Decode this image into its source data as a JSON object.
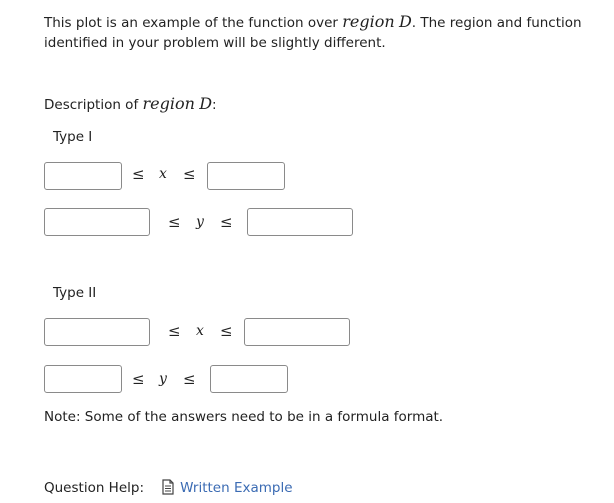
{
  "intro": {
    "text_before": "This plot is an example of the function over ",
    "math_term": "region",
    "math_symbol": "D",
    "text_after": ".  The region and function identified in your problem will be slightly different."
  },
  "description": {
    "label": "Description of ",
    "math_term": "region",
    "math_symbol": "D",
    "suffix": ":"
  },
  "type1": {
    "label": "Type I",
    "row1": {
      "lower_value": "",
      "op_left": "≤",
      "variable": "x",
      "op_right": "≤",
      "upper_value": ""
    },
    "row2": {
      "lower_value": "",
      "op_left": "≤",
      "variable": "y",
      "op_right": "≤",
      "upper_value": ""
    }
  },
  "type2": {
    "label": "Type II",
    "row1": {
      "lower_value": "",
      "op_left": "≤",
      "variable": "x",
      "op_right": "≤",
      "upper_value": ""
    },
    "row2": {
      "lower_value": "",
      "op_left": "≤",
      "variable": "y",
      "op_right": "≤",
      "upper_value": ""
    }
  },
  "note": "Note:  Some of the answers need to be in a formula format.",
  "help": {
    "label": "Question Help:",
    "icon": "document-icon",
    "link_text": "Written Example",
    "link_color": "#3b6bb3"
  }
}
